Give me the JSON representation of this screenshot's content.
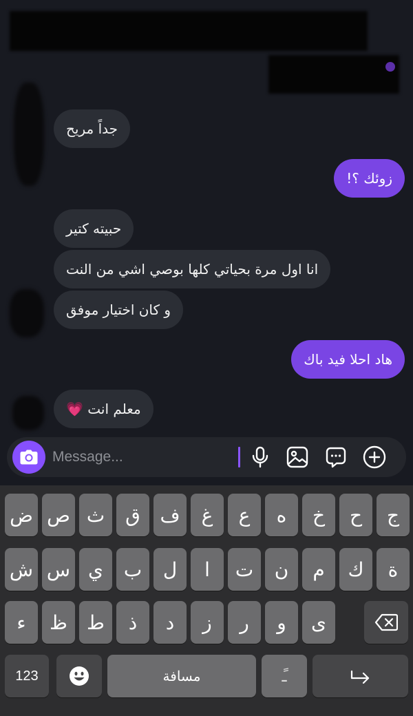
{
  "messages": [
    {
      "id": "m1",
      "dir": "in",
      "text": "جداً مريح"
    },
    {
      "id": "m2",
      "dir": "out",
      "text": "زوئك ؟!"
    },
    {
      "id": "m3",
      "dir": "in",
      "text": "حبيته كتير"
    },
    {
      "id": "m4",
      "dir": "in",
      "text": "انا اول مرة بحياتي كلها بوصي اشي من النت"
    },
    {
      "id": "m5",
      "dir": "in",
      "text": "و كان اختيار موفق"
    },
    {
      "id": "m6",
      "dir": "out",
      "text": "هاد احلا فيد باك"
    },
    {
      "id": "m7",
      "dir": "in",
      "text": "معلم انت 💗"
    }
  ],
  "composer": {
    "placeholder": "Message...",
    "icons": [
      "camera-icon",
      "microphone-icon",
      "image-icon",
      "sticker-chat-icon",
      "plus-icon"
    ]
  },
  "keyboard": {
    "row1": [
      "ض",
      "ص",
      "ث",
      "ق",
      "ف",
      "غ",
      "ع",
      "ه",
      "خ",
      "ح",
      "ج"
    ],
    "row2": [
      "ش",
      "س",
      "ي",
      "ب",
      "ل",
      "ا",
      "ت",
      "ن",
      "م",
      "ك",
      "ة"
    ],
    "row3": [
      "ء",
      "ظ",
      "ط",
      "ذ",
      "د",
      "ز",
      "ر",
      "و",
      "ى"
    ],
    "numbers_label": "123",
    "space_label": "مسافة",
    "diacritic_label": "ًـ"
  },
  "colors": {
    "chat_bg": "#181a21",
    "incoming_bubble": "#2b2e35",
    "outgoing_bubble": "#7a45e4",
    "accent": "#8750ff",
    "keyboard_bg": "#2d2d2f",
    "key": "#6c6c6e",
    "key_dark": "#464648"
  }
}
